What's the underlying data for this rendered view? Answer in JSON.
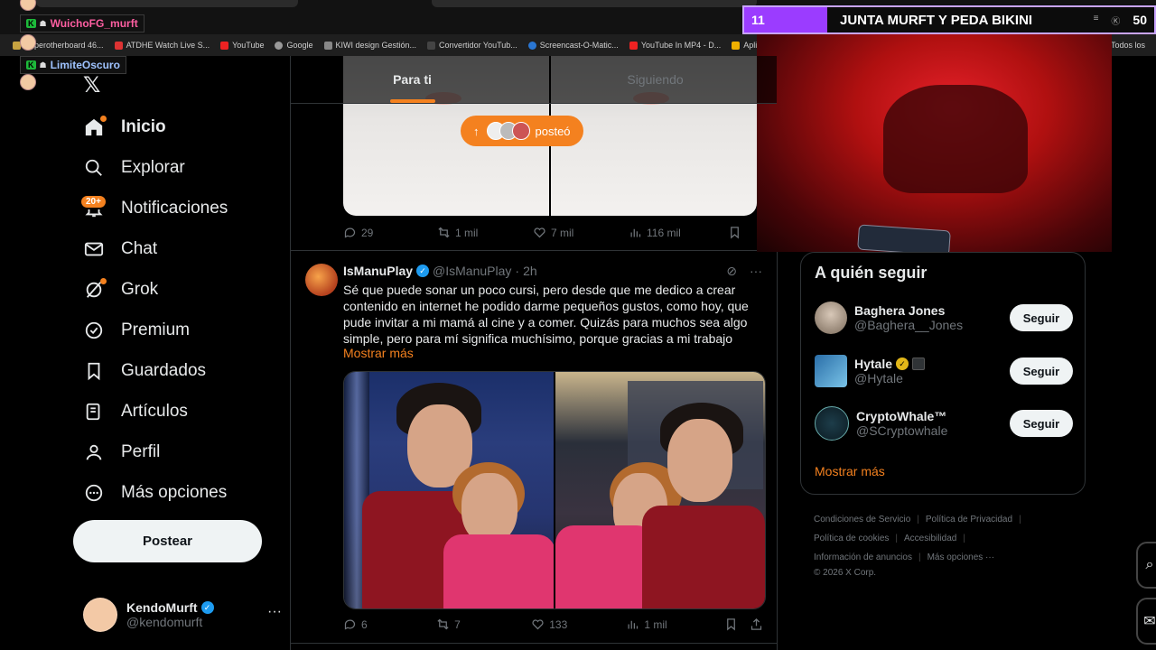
{
  "bookmarks": [
    {
      "label": "Hyperotherboard 46...",
      "color": "#c7a341"
    },
    {
      "label": "ATDHE Watch Live S...",
      "color": "#d33"
    },
    {
      "label": "YouTube",
      "color": "#e22"
    },
    {
      "label": "Google",
      "color": "#999"
    },
    {
      "label": "KIWI design Gestión...",
      "color": "#888"
    },
    {
      "label": "Convertidor YouTub...",
      "color": "#444"
    },
    {
      "label": "Screencast-O-Matic...",
      "color": "#2a76d2"
    },
    {
      "label": "YouTube In MP4 - D...",
      "color": "#e22"
    },
    {
      "label": "Aplicaciones",
      "color": "#f0b000"
    }
  ],
  "bookmarks_right": "Todos los",
  "chat": {
    "user1": "WuichoFG_murft",
    "user2": "LimiteOscuro",
    "user1_color": "#ff5fa2",
    "user2_color": "#9fc3ff"
  },
  "stream_bar": {
    "number": "11",
    "title": "JUNTA MURFT Y PEDA BIKINI",
    "count": "50"
  },
  "nav": {
    "items": [
      {
        "label": "Inicio",
        "icon": "home-icon"
      },
      {
        "label": "Explorar",
        "icon": "search-icon"
      },
      {
        "label": "Notificaciones",
        "icon": "bell-icon",
        "badge": "20+"
      },
      {
        "label": "Chat",
        "icon": "mail-icon"
      },
      {
        "label": "Grok",
        "icon": "grok-icon"
      },
      {
        "label": "Premium",
        "icon": "verified-icon"
      },
      {
        "label": "Guardados",
        "icon": "bookmark-icon"
      },
      {
        "label": "Artículos",
        "icon": "article-icon"
      },
      {
        "label": "Perfil",
        "icon": "person-icon"
      },
      {
        "label": "Más opciones",
        "icon": "more-circle-icon"
      }
    ],
    "post_button": "Postear"
  },
  "account": {
    "name": "KendoMurft",
    "handle": "@kendomurft"
  },
  "feed": {
    "tabs": [
      "Para ti",
      "Siguiendo"
    ],
    "posted_pill": "posteó",
    "tweet1_stats": {
      "replies": "29",
      "retweets": "1 mil",
      "likes": "7 mil",
      "views": "116 mil"
    },
    "tweet2": {
      "name": "IsManuPlay",
      "handle": "@IsManuPlay",
      "time": "2h",
      "text": "Sé que puede sonar un poco cursi, pero desde que me dedico a crear contenido en internet he podido darme pequeños gustos, como hoy, que pude invitar a mi mamá al cine y a comer. Quizás para muchos sea algo simple, pero para mí significa muchísimo, porque gracias a mi trabajo",
      "show_more": "Mostrar más",
      "stats": {
        "replies": "6",
        "retweets": "7",
        "likes": "133",
        "views": "1 mil"
      }
    }
  },
  "who_to_follow": {
    "title": "A quién seguir",
    "accounts": [
      {
        "name": "Baghera Jones",
        "handle": "@Baghera__Jones"
      },
      {
        "name": "Hytale",
        "handle": "@Hytale"
      },
      {
        "name": "CryptoWhale™",
        "handle": "@SCryptowhale"
      }
    ],
    "follow_label": "Seguir",
    "show_more": "Mostrar más"
  },
  "footer": {
    "links": [
      "Condiciones de Servicio",
      "Política de Privacidad",
      "Política de cookies",
      "Accesibilidad",
      "Información de anuncios",
      "Más opciones ···"
    ],
    "copyright": "© 2026 X Corp."
  },
  "colors": {
    "accent": "#f4811f",
    "verified": "#1d9bf0",
    "gold": "#e2b719"
  }
}
